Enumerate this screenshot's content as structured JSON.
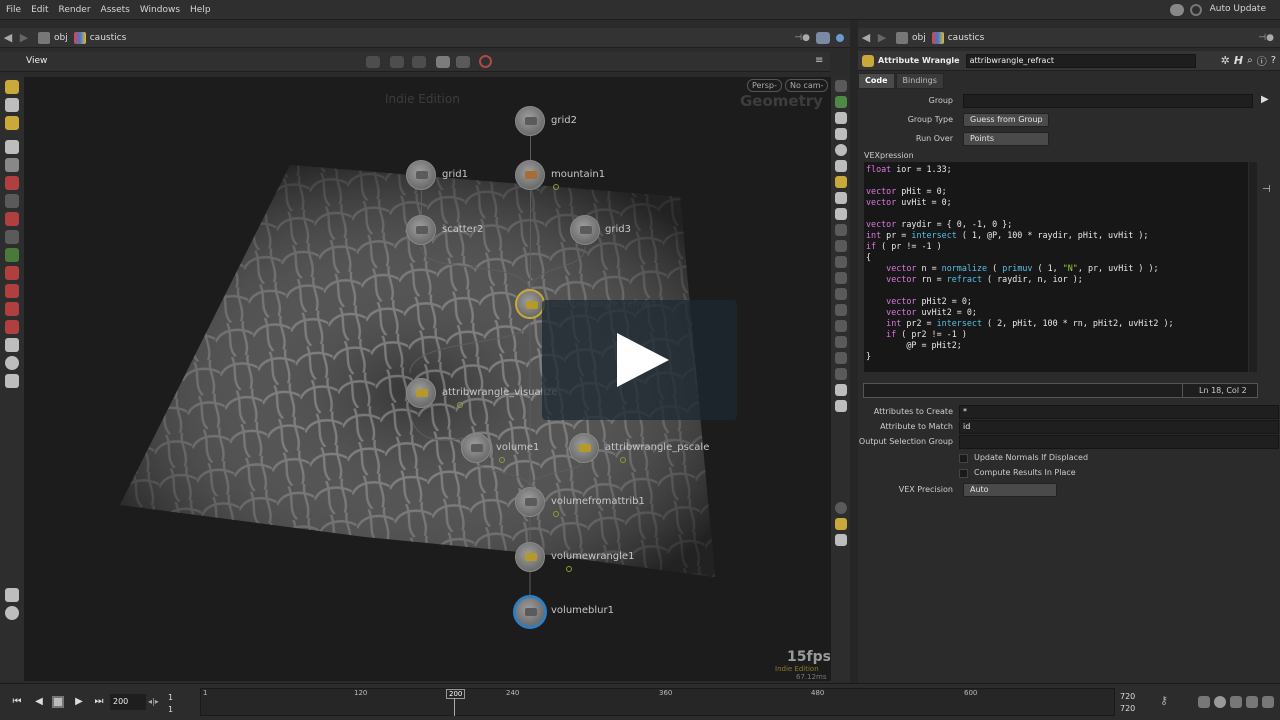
{
  "menu": [
    "File",
    "Edit",
    "Render",
    "Assets",
    "Windows",
    "Help"
  ],
  "auto_update": "Auto Update",
  "left_path": {
    "root": "obj",
    "node": "caustics"
  },
  "right_path": {
    "root": "obj",
    "node": "caustics"
  },
  "viewer": {
    "tab_label": "View",
    "persp": "Persp-",
    "cam": "No cam-",
    "watermark": "Indie Edition",
    "context_label": "Geometry",
    "fps": "15fps",
    "fps_sub1": "Indie Edition",
    "fps_sub2": "67.12ms"
  },
  "nodes": [
    {
      "name": "grid2"
    },
    {
      "name": "grid1"
    },
    {
      "name": "mountain1"
    },
    {
      "name": "scatter2"
    },
    {
      "name": "grid3"
    },
    {
      "name": "attribwrangle_refract"
    },
    {
      "name": "attribwrangle_visualize"
    },
    {
      "name": "volume1"
    },
    {
      "name": "attribwrangle_pscale"
    },
    {
      "name": "volumefromattrib1"
    },
    {
      "name": "volumewrangle1"
    },
    {
      "name": "volumeblur1"
    }
  ],
  "parm": {
    "node_type": "Attribute Wrangle",
    "node_name": "attribwrangle_refract",
    "tabs": [
      "Code",
      "Bindings"
    ],
    "group_label": "Group",
    "group_value": "",
    "group_type_label": "Group Type",
    "group_type_value": "Guess from Group",
    "run_over_label": "Run Over",
    "run_over_value": "Points",
    "vex_label": "VEXpression",
    "cursor_pos": "Ln 18, Col 2",
    "attrs_create_label": "Attributes to Create",
    "attrs_create_value": "*",
    "attr_match_label": "Attribute to Match",
    "attr_match_value": "id",
    "output_sel_label": "Output Selection Group",
    "output_sel_value": "",
    "update_normals": "Update Normals If Displaced",
    "compute_in_place": "Compute Results In Place",
    "vex_precision_label": "VEX Precision",
    "vex_precision_value": "Auto"
  },
  "code_lines": [
    "float ior = 1.33;",
    "",
    "vector pHit = 0;",
    "vector uvHit = 0;",
    "",
    "vector raydir = { 0, -1, 0 };",
    "int pr = intersect ( 1, @P, 100 * raydir, pHit, uvHit );",
    "if ( pr != -1 )",
    "{",
    "    vector n = normalize ( primuv ( 1, \"N\", pr, uvHit ) );",
    "    vector rn = refract ( raydir, n, ior );",
    "",
    "    vector pHit2 = 0;",
    "    vector uvHit2 = 0;",
    "    int pr2 = intersect ( 2, pHit, 100 * rn, pHit2, uvHit2 );",
    "    if ( pr2 != -1 )",
    "        @P = pHit2;",
    "}"
  ],
  "timeline": {
    "current_frame": "200",
    "start_a": "1",
    "start_b": "1",
    "end_a": "720",
    "end_b": "720",
    "ticks": [
      "1",
      "120",
      "200",
      "240",
      "360",
      "480",
      "600"
    ],
    "playhead": "200"
  },
  "colors": {
    "accent": "#c9a93a",
    "keyword": "#dd77dd",
    "function": "#55c0ea",
    "string": "#9ac93a"
  }
}
